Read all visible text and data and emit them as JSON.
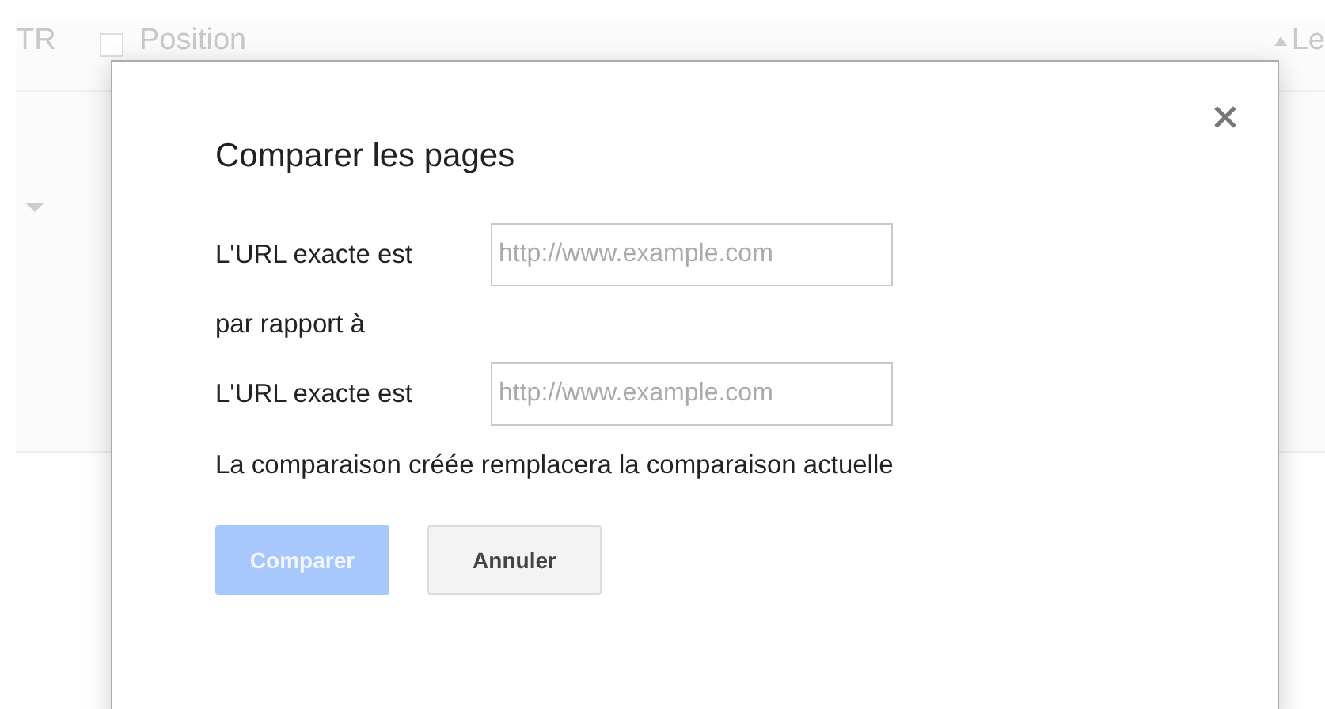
{
  "background": {
    "columns": [
      {
        "kind": "text",
        "label": "TR"
      },
      {
        "kind": "checkbox",
        "label": "Position",
        "checked": false
      },
      {
        "kind": "sort",
        "label": "Le"
      }
    ]
  },
  "dialog": {
    "title": "Comparer les pages",
    "rows": [
      {
        "kind": "field",
        "label": "L'URL exacte est",
        "placeholder": "http://www.example.com"
      },
      {
        "kind": "text",
        "label": "par rapport à"
      },
      {
        "kind": "field",
        "label": "L'URL exacte est",
        "placeholder": "http://www.example.com"
      }
    ],
    "note": "La comparaison créée remplacera la comparaison actuelle",
    "buttons": [
      {
        "label": "Comparer",
        "kind": "primary",
        "disabled": true
      },
      {
        "label": "Annuler",
        "kind": "secondary",
        "disabled": false
      }
    ]
  }
}
